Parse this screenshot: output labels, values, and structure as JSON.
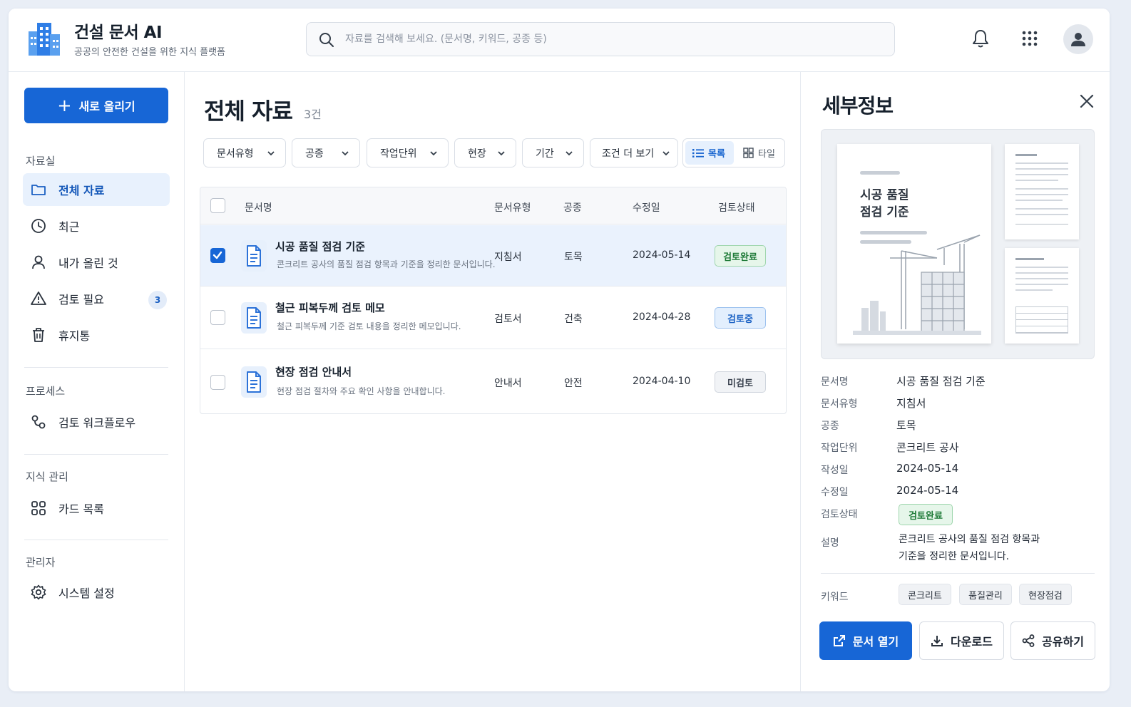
{
  "app": {
    "title": "건설 문서 AI",
    "subtitle": "공공의 안전한 건설을 위한 지식 플랫폼"
  },
  "search": {
    "placeholder": "자료를 검색해 보세요. (문서명, 키워드, 공종 등)",
    "value": ""
  },
  "header_icons": [
    "bell-icon",
    "apps-grid-icon",
    "user-avatar-icon"
  ],
  "sidebar": {
    "upload_label": "새로 올리기",
    "sections": {
      "library": "자료실",
      "process": "프로세스",
      "knowledge": "지식 관리",
      "admin": "관리자"
    },
    "items": [
      {
        "label": "전체 자료",
        "icon": "folder-icon",
        "active": true
      },
      {
        "label": "최근",
        "icon": "clock-icon"
      },
      {
        "label": "내가 올린 것",
        "icon": "user-icon"
      },
      {
        "label": "검토 필요",
        "icon": "warning-icon",
        "badge": "3"
      },
      {
        "label": "휴지통",
        "icon": "trash-icon"
      },
      {
        "label": "검토 워크플로우",
        "icon": "workflow-icon"
      },
      {
        "label": "카드 목록",
        "icon": "grid-icon"
      },
      {
        "label": "시스템 설정",
        "icon": "gear-icon"
      }
    ]
  },
  "main": {
    "title": "전체 자료",
    "count": "3건",
    "filters": [
      "문서유형",
      "공종",
      "작업단위",
      "현장",
      "기간",
      "조건 더 보기"
    ],
    "view_toggle": {
      "list": "목록",
      "tile": "타일",
      "selected": "list"
    },
    "columns": [
      "문서명",
      "문서유형",
      "공종",
      "수정일",
      "검토상태"
    ],
    "rows": [
      {
        "title": "시공 품질 점검 기준",
        "desc": "콘크리트 공사의 품질 점검 항목과 기준을 정리한 문서입니다.",
        "type": "지침서",
        "trade": "토목",
        "modified": "2024-05-14",
        "status": "검토완료",
        "selected": true
      },
      {
        "title": "철근 피복두께 검토 메모",
        "desc": "철근 피복두께 기준 검토 내용을 정리한 메모입니다.",
        "type": "검토서",
        "trade": "건축",
        "modified": "2024-04-28",
        "status": "검토중",
        "selected": false
      },
      {
        "title": "현장 점검 안내서",
        "desc": "현장 점검 절차와 주요 확인 사항을 안내합니다.",
        "type": "안내서",
        "trade": "안전",
        "modified": "2024-04-10",
        "status": "미검토",
        "selected": false
      }
    ]
  },
  "detail": {
    "title": "세부정보",
    "preview_title_line1": "시공 품질",
    "preview_title_line2": "점검 기준",
    "fields": [
      {
        "label": "문서명",
        "value": "시공 품질 점검 기준"
      },
      {
        "label": "문서유형",
        "value": "지침서"
      },
      {
        "label": "공종",
        "value": "토목"
      },
      {
        "label": "작업단위",
        "value": "콘크리트 공사"
      },
      {
        "label": "작성일",
        "value": "2024-05-14"
      },
      {
        "label": "수정일",
        "value": "2024-05-14"
      }
    ],
    "status_label": "검토상태",
    "status_value": "검토완료",
    "desc_label": "설명",
    "desc_line1": "콘크리트 공사의 품질 점검 항목과",
    "desc_line2": "기준을 정리한 문서입니다.",
    "keyword_label": "키워드",
    "keywords": [
      "콘크리트",
      "품질관리",
      "현장점검"
    ],
    "actions": {
      "open": "문서 열기",
      "download": "다운로드",
      "share": "공유하기"
    }
  },
  "colors": {
    "primary": "#1766d6",
    "active_nav_bg": "#e8f1fd",
    "status_done": "#1e7a37",
    "status_in_review": "#1b62c4"
  }
}
